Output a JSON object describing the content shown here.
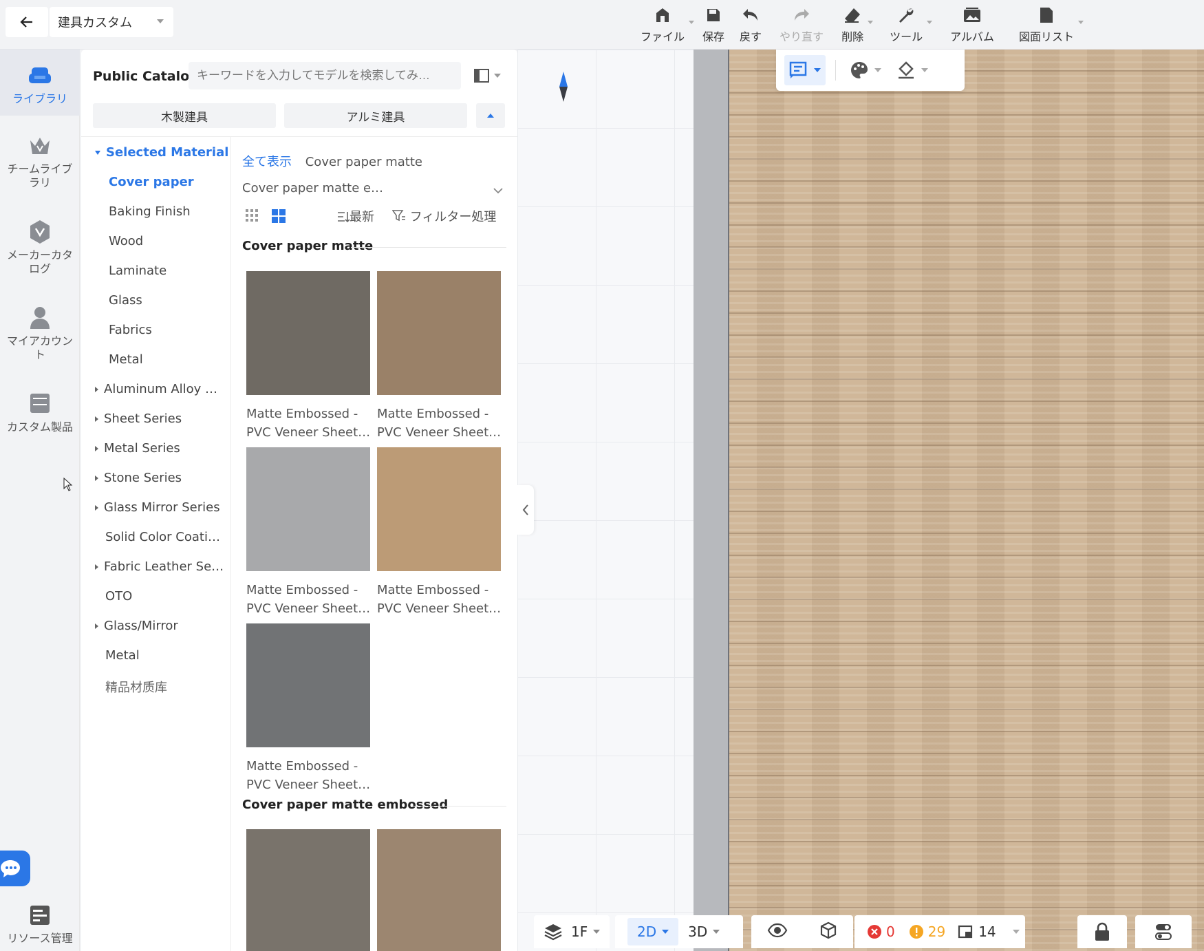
{
  "project": {
    "name": "建具カスタム"
  },
  "toolbar": {
    "file": "ファイル",
    "save": "保存",
    "undo": "戻す",
    "redo": "やり直す",
    "delete": "削除",
    "tools": "ツール",
    "album": "アルバム",
    "drawing_list": "図面リスト"
  },
  "leftnav": {
    "library": "ライブラリ",
    "team_library": "チームライブラリ",
    "maker_catalog": "メーカーカタログ",
    "my_account": "マイアカウント",
    "custom_products": "カスタム製品",
    "resource_management": "リソース管理"
  },
  "catalog": {
    "title": "Public Catalog",
    "search_placeholder": "キーワードを入力してモデルを検索してみ…",
    "tabs": [
      "木製建具",
      "アルミ建具"
    ]
  },
  "tree": {
    "head": "Selected Material",
    "children": [
      "Cover paper",
      "Baking Finish",
      "Wood",
      "Laminate",
      "Glass",
      "Fabrics",
      "Metal"
    ],
    "groups": [
      "Aluminum Alloy …",
      "Sheet Series",
      "Metal Series",
      "Stone Series",
      "Glass Mirror Series",
      "Solid Color Coati…",
      "Fabric Leather Se…",
      "OTO",
      "Glass/Mirror",
      "Metal",
      "精品材质库"
    ]
  },
  "content": {
    "show_all": "全て表示",
    "current": "Cover paper matte",
    "sub_select": "Cover paper matte e…",
    "sort": "最新",
    "filter": "フィルター処理",
    "sections": [
      {
        "title": "Cover paper matte",
        "items": [
          {
            "line1": "Matte Embossed -",
            "line2": "PVC Veneer Sheet…",
            "color": "#6f6a63"
          },
          {
            "line1": "Matte Embossed -",
            "line2": "PVC Veneer Sheet…",
            "color": "#9a8168"
          },
          {
            "line1": "Matte Embossed -",
            "line2": "PVC Veneer Sheet…",
            "color": "#a8a9ab"
          },
          {
            "line1": "Matte Embossed -",
            "line2": "PVC Veneer Sheet…",
            "color": "#bc9b76"
          },
          {
            "line1": "Matte Embossed -",
            "line2": "PVC Veneer Sheet…",
            "color": "#717375"
          }
        ]
      },
      {
        "title": "Cover paper matte embossed",
        "items": [
          {
            "color": "#79736b"
          },
          {
            "color": "#9c8670"
          }
        ]
      }
    ]
  },
  "bottombar": {
    "floor": "1F",
    "view2d": "2D",
    "view3d": "3D",
    "errors": "0",
    "warnings": "29",
    "rooms": "14"
  },
  "colors": {
    "accent": "#2b77e6",
    "error": "#e53935",
    "warning": "#f5a623"
  }
}
